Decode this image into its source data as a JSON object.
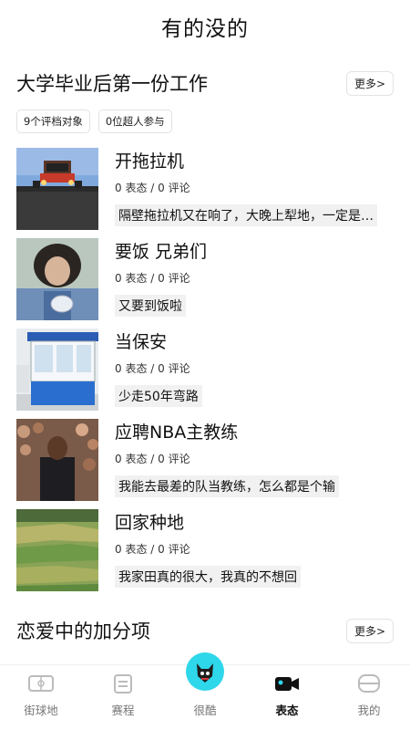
{
  "header": {
    "title": "有的没的"
  },
  "section1": {
    "title": "大学毕业后第一份工作",
    "more_label": "更多>",
    "tags": [
      "9个评档对象",
      "0位超人参与"
    ],
    "items": [
      {
        "title": "开拖拉机",
        "stats": "0 表态 / 0 评论",
        "quote": "隔壁拖拉机又在响了，大晚上犁地，一定是…"
      },
      {
        "title": "要饭 兄弟们",
        "stats": "0 表态 / 0 评论",
        "quote": "又要到饭啦"
      },
      {
        "title": "当保安",
        "stats": "0 表态 / 0 评论",
        "quote": "少走50年弯路"
      },
      {
        "title": "应聘NBA主教练",
        "stats": "0 表态 / 0 评论",
        "quote": "我能去最差的队当教练，怎么都是个输"
      },
      {
        "title": "回家种地",
        "stats": "0 表态 / 0 评论",
        "quote": "我家田真的很大，我真的不想回"
      }
    ]
  },
  "section2": {
    "title": "恋爱中的加分项",
    "more_label": "更多>"
  },
  "tabbar": {
    "tabs": [
      {
        "label": "街球地",
        "icon": "court-icon"
      },
      {
        "label": "赛程",
        "icon": "schedule-icon"
      },
      {
        "label": "很酷",
        "icon": "mascot-icon"
      },
      {
        "label": "表态",
        "icon": "camera-icon",
        "active": true
      },
      {
        "label": "我的",
        "icon": "profile-icon"
      }
    ],
    "accent": "#2fd7ea"
  }
}
